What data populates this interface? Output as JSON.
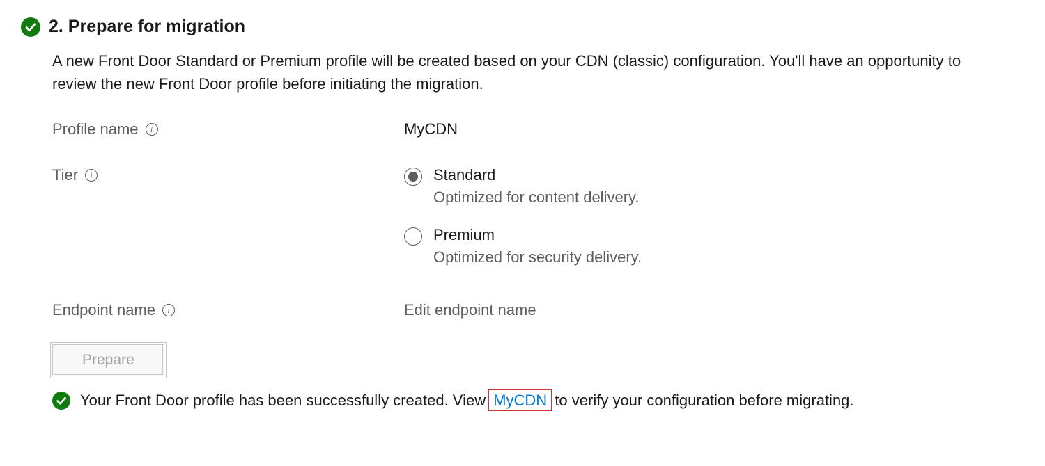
{
  "step": {
    "title": "2. Prepare for migration",
    "description": "A new Front Door Standard or Premium profile will be created based on your CDN (classic) configuration. You'll have an opportunity to review the new Front Door profile before initiating the migration."
  },
  "fields": {
    "profile_name_label": "Profile name",
    "profile_name_value": "MyCDN",
    "tier_label": "Tier",
    "endpoint_label": "Endpoint name",
    "endpoint_value": "Edit endpoint name"
  },
  "tiers": {
    "standard": {
      "label": "Standard",
      "sub": "Optimized for content delivery."
    },
    "premium": {
      "label": "Premium",
      "sub": "Optimized for security delivery."
    }
  },
  "actions": {
    "prepare_label": "Prepare"
  },
  "status": {
    "pre": "Your Front Door profile has been successfully created. View ",
    "link": "MyCDN",
    "post": " to verify your configuration before migrating."
  }
}
